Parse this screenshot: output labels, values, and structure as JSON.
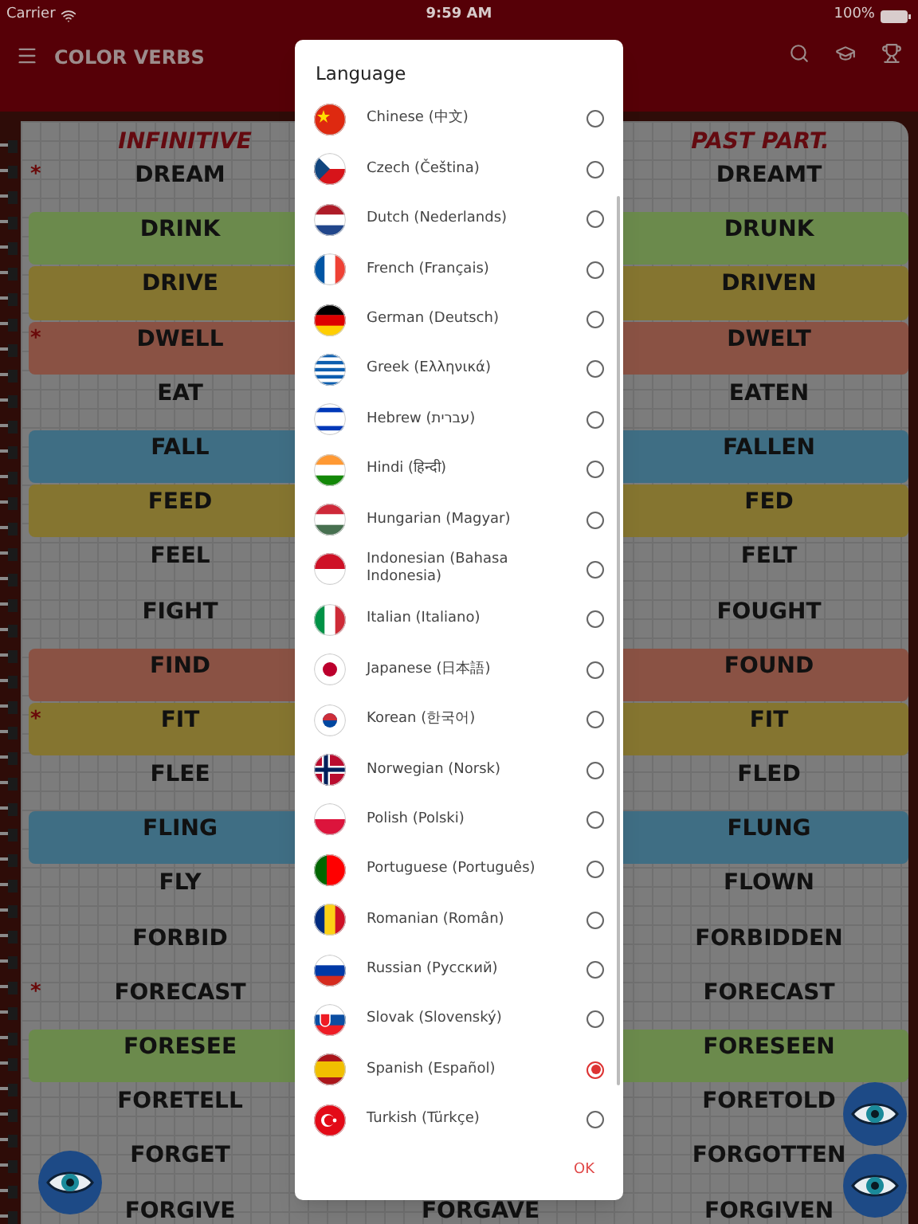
{
  "status_bar": {
    "carrier": "Carrier",
    "time": "9:59 AM",
    "battery": "100%"
  },
  "app_bar": {
    "title": "COLOR VERBS"
  },
  "table": {
    "columns": [
      "INFINITIVE",
      "PAST PART."
    ],
    "rows": [
      {
        "infinitive": "DREAM",
        "past_part": "DREAMT",
        "marker": "*"
      },
      {
        "infinitive": "DRINK",
        "past_part": "DRUNK",
        "color": "#6b8a4c"
      },
      {
        "infinitive": "DRIVE",
        "past_part": "DRIVEN",
        "color": "#857530"
      },
      {
        "infinitive": "DWELL",
        "past_part": "DWELT",
        "marker": "*",
        "color": "#8a5244"
      },
      {
        "infinitive": "EAT",
        "past_part": "EATEN"
      },
      {
        "infinitive": "FALL",
        "past_part": "FALLEN",
        "color": "#3f6e84"
      },
      {
        "infinitive": "FEED",
        "past_part": "FED",
        "color": "#857530"
      },
      {
        "infinitive": "FEEL",
        "past_part": "FELT"
      },
      {
        "infinitive": "FIGHT",
        "past_part": "FOUGHT"
      },
      {
        "infinitive": "FIND",
        "past_part": "FOUND",
        "color": "#8a5244"
      },
      {
        "infinitive": "FIT",
        "past_part": "FIT",
        "marker": "*",
        "color": "#857530"
      },
      {
        "infinitive": "FLEE",
        "past_part": "FLED"
      },
      {
        "infinitive": "FLING",
        "past_part": "FLUNG",
        "color": "#3f6e84"
      },
      {
        "infinitive": "FLY",
        "past_part": "FLOWN"
      },
      {
        "infinitive": "FORBID",
        "past_part": "FORBIDDEN"
      },
      {
        "infinitive": "FORECAST",
        "past_part": "FORECAST",
        "marker": "*"
      },
      {
        "infinitive": "FORESEE",
        "past_part": "FORESEEN",
        "color": "#6b8a4c"
      },
      {
        "infinitive": "FORETELL",
        "past_part": "FORETOLD"
      },
      {
        "infinitive": "FORGET",
        "past_part": "FORGOTTEN"
      },
      {
        "infinitive": "FORGIVE",
        "past_part": "FORGIVEN",
        "column_2": "FORGAVE"
      }
    ]
  },
  "dialog": {
    "title": "Language",
    "ok": "OK",
    "languages": [
      {
        "label": "Chinese (中文)",
        "selected": false
      },
      {
        "label": "Czech (Čeština)",
        "selected": false
      },
      {
        "label": "Dutch (Nederlands)",
        "selected": false
      },
      {
        "label": "French (Français)",
        "selected": false
      },
      {
        "label": "German (Deutsch)",
        "selected": false
      },
      {
        "label": "Greek (Ελληνικά)",
        "selected": false
      },
      {
        "label": "Hebrew (עברית)",
        "selected": false
      },
      {
        "label": "Hindi (हिन्दी)",
        "selected": false
      },
      {
        "label": "Hungarian (Magyar)",
        "selected": false
      },
      {
        "label": "Indonesian (Bahasa Indonesia)",
        "selected": false
      },
      {
        "label": "Italian (Italiano)",
        "selected": false
      },
      {
        "label": "Japanese (日本語)",
        "selected": false
      },
      {
        "label": "Korean (한국어)",
        "selected": false
      },
      {
        "label": "Norwegian (Norsk)",
        "selected": false
      },
      {
        "label": "Polish (Polski)",
        "selected": false
      },
      {
        "label": "Portuguese (Português)",
        "selected": false
      },
      {
        "label": "Romanian (Român)",
        "selected": false
      },
      {
        "label": "Russian (Русский)",
        "selected": false
      },
      {
        "label": "Slovak (Slovenský)",
        "selected": false
      },
      {
        "label": "Spanish (Español)",
        "selected": true
      },
      {
        "label": "Turkish (Türkçe)",
        "selected": false
      }
    ]
  }
}
